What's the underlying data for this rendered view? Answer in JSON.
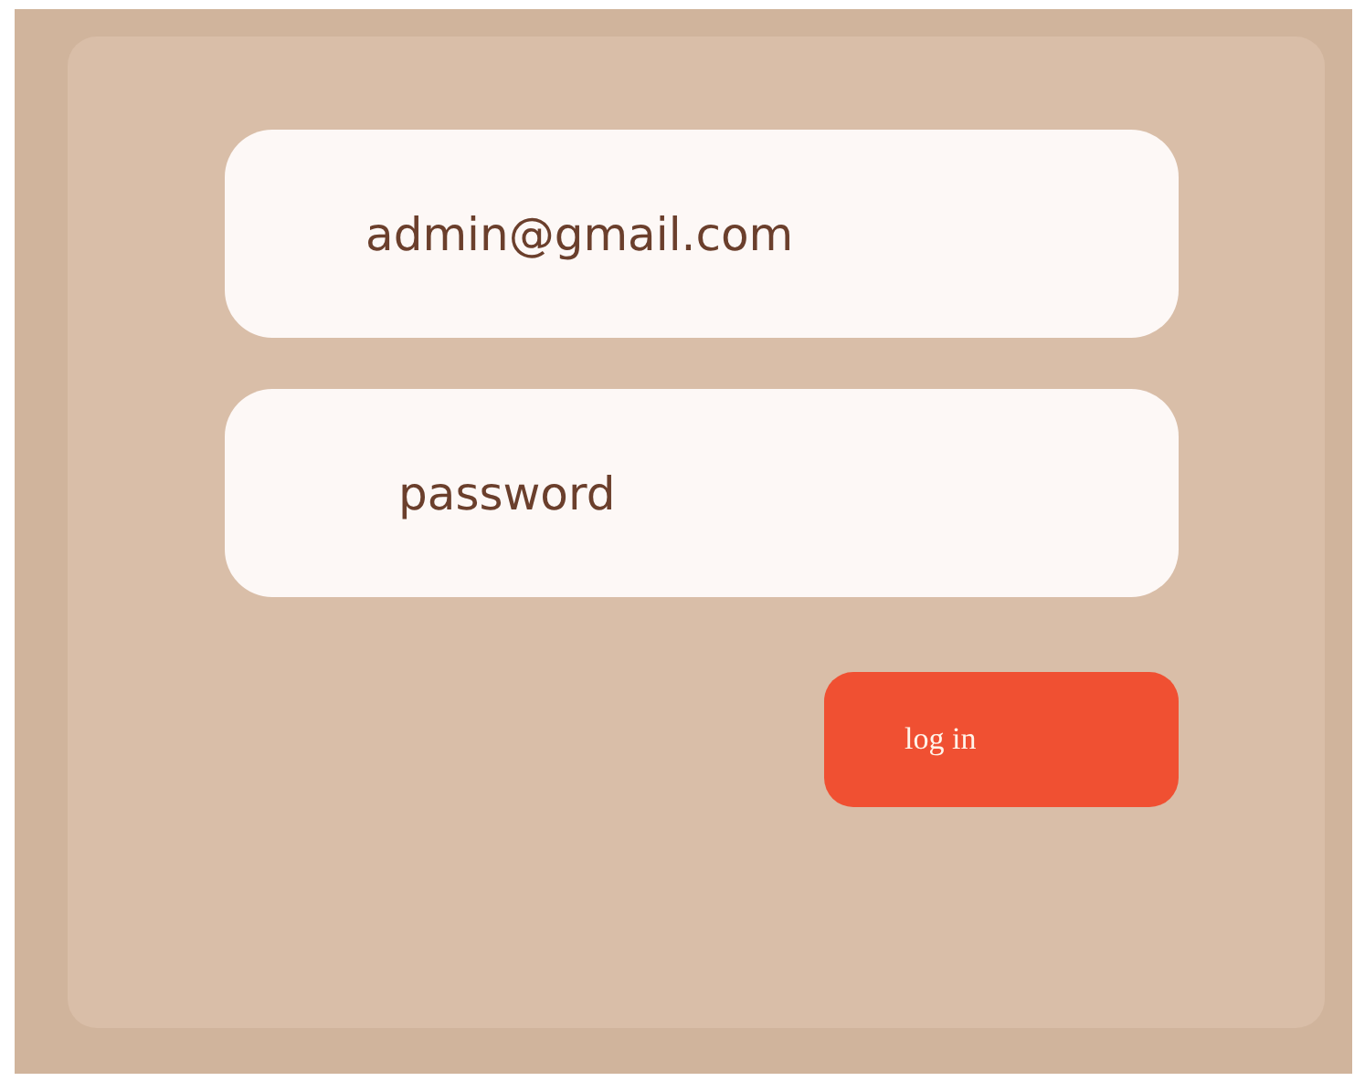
{
  "email_field": {
    "value": "admin@gmail.com"
  },
  "password_field": {
    "placeholder": "password"
  },
  "login_button": {
    "label": "log in"
  }
}
